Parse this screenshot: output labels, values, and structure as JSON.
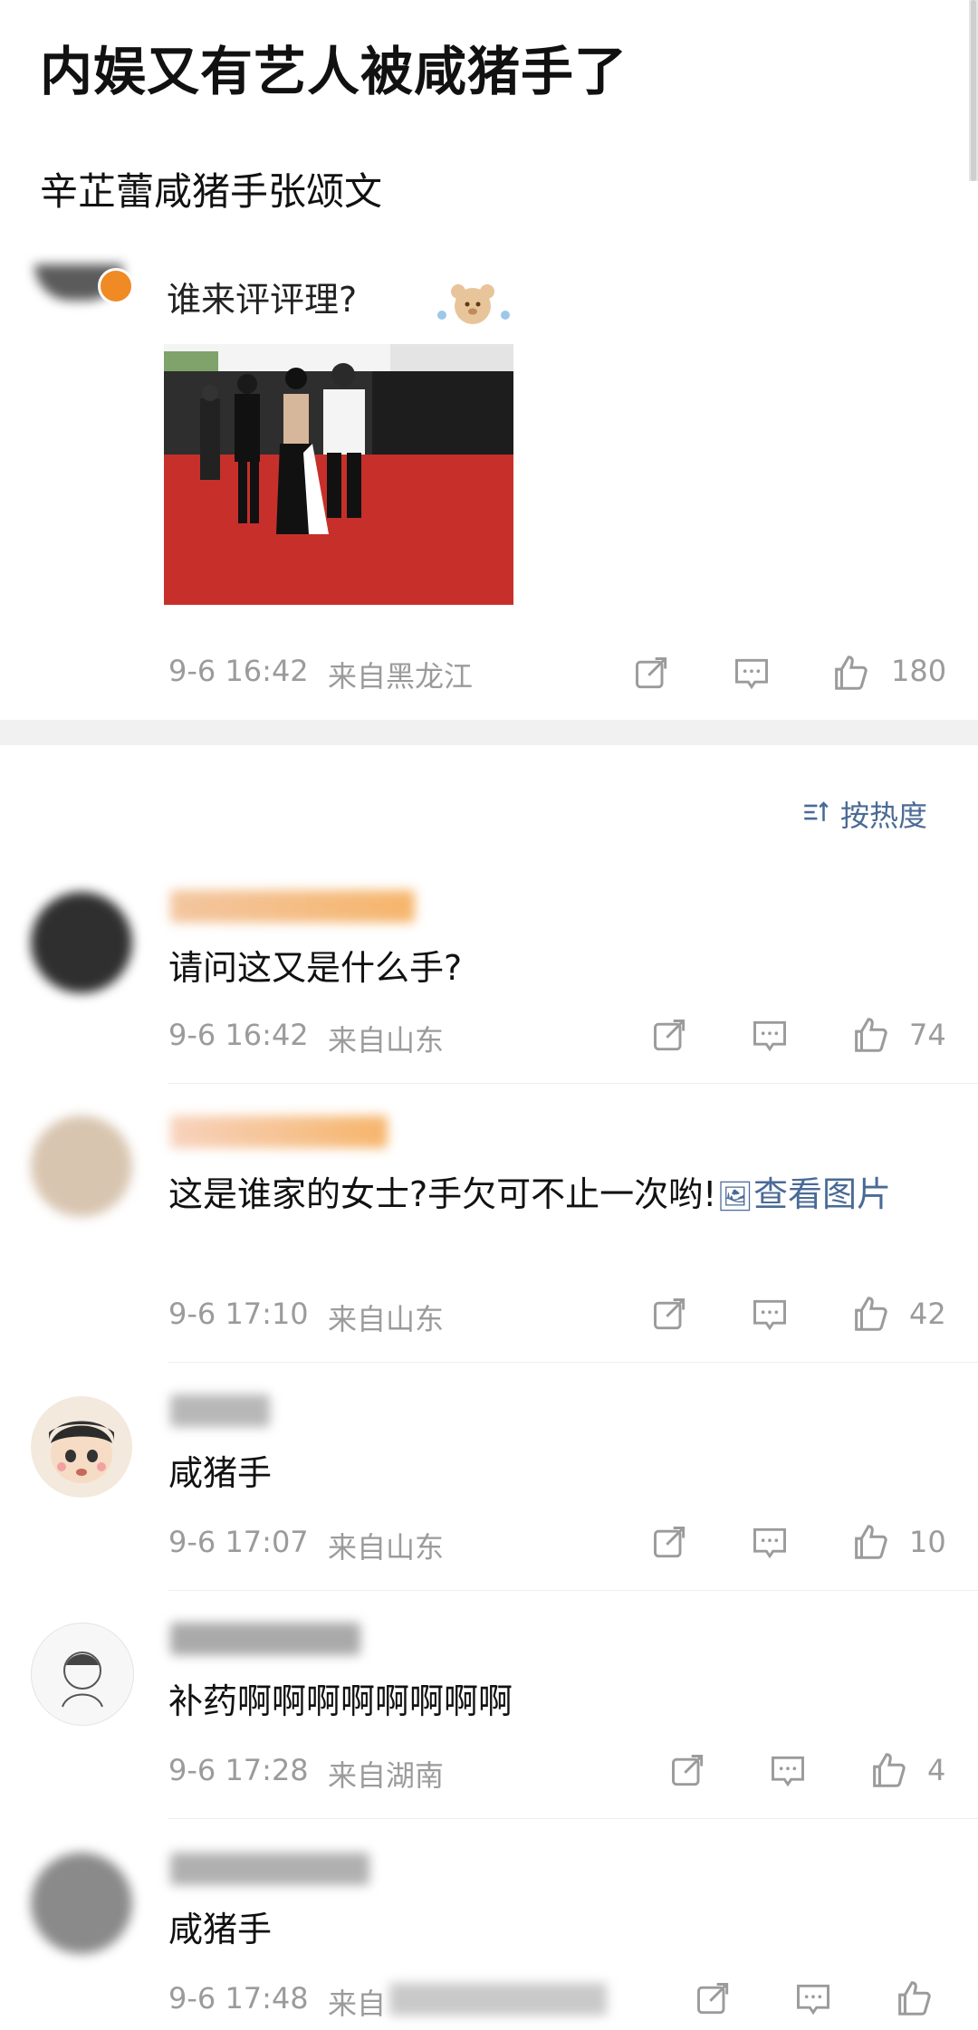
{
  "header": {
    "title": "内娱又有艺人被咸猪手了",
    "subtitle": "辛芷蕾咸猪手张颂文"
  },
  "post": {
    "caption": "谁来评评理?",
    "time": "9-6 16:42",
    "location": "来自黑龙江",
    "likes": "180"
  },
  "sort": {
    "label": "按热度"
  },
  "comments": [
    {
      "text": "请问这又是什么手?",
      "time": "9-6 16:42",
      "location": "来自山东",
      "likes": "74"
    },
    {
      "text": "这是谁家的女士?手欠可不止一次哟!",
      "link": "查看图片",
      "time": "9-6 17:10",
      "location": "来自山东",
      "likes": "42"
    },
    {
      "text": "咸猪手",
      "time": "9-6 17:07",
      "location": "来自山东",
      "likes": "10"
    },
    {
      "text": "补药啊啊啊啊啊啊啊啊",
      "time": "9-6 17:28",
      "location": "来自湖南",
      "likes": "4"
    },
    {
      "text": "咸猪手",
      "time": "9-6 17:48",
      "location": "来自",
      "likes": ""
    }
  ],
  "colors": {
    "link": "#4a6a96",
    "meta": "#9b9b9b",
    "verified": "#f08a24",
    "carpet": "#c7302a"
  }
}
